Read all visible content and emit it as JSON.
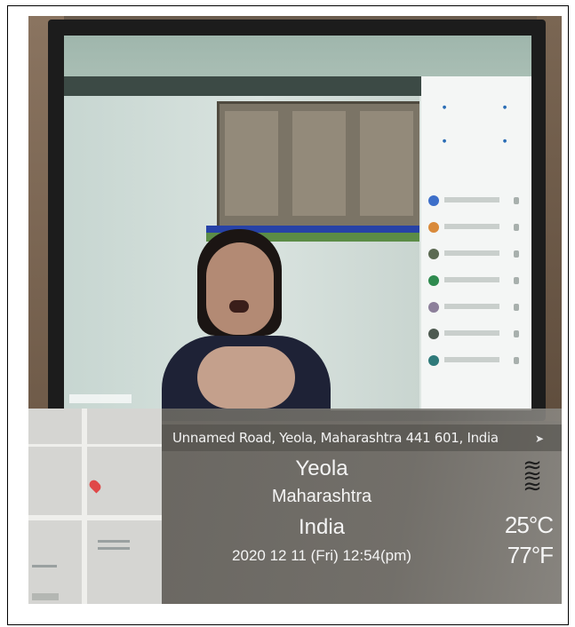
{
  "geotag": {
    "address": "Unnamed Road, Yeola, Maharashtra 441 601, India",
    "city": "Yeola",
    "state": "Maharashtra",
    "country": "India",
    "datetime": "2020 12 11 (Fri) 12:54(pm)",
    "temp_c": "25°C",
    "temp_f": "77°F",
    "weather_icon": "fog-icon"
  },
  "colors": {
    "overlay": "#74726d",
    "map": "#d5d5d2",
    "pin": "#e04848"
  }
}
